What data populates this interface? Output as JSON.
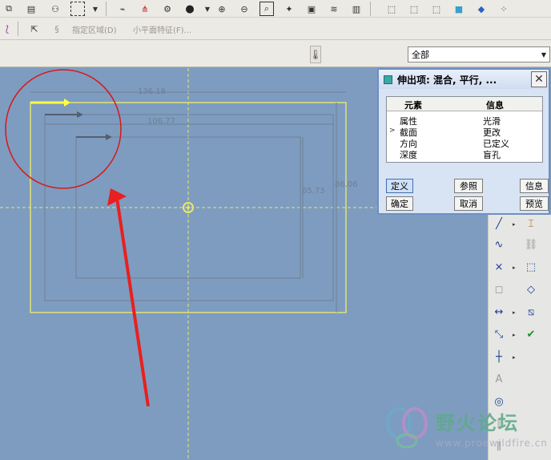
{
  "toolbar_row2": {
    "item_specify_region": "指定区域(D)",
    "item_small_surface": "小平面特征(F)..."
  },
  "toolbar_row3": {
    "filter_value": "全部"
  },
  "dimensions": {
    "width_outer": "136.18",
    "width_inner": "106.77",
    "height_inner": "65.73",
    "height_outer": "86.06"
  },
  "dialog": {
    "title": "伸出项: 混合, 平行, ...",
    "close_label": "✕",
    "columns": [
      "元素",
      "信息"
    ],
    "rows": [
      {
        "element": "属性",
        "info": "光滑"
      },
      {
        "element": "截面",
        "info": "更改",
        "current": true
      },
      {
        "element": "方向",
        "info": "已定义"
      },
      {
        "element": "深度",
        "info": "盲孔"
      }
    ],
    "buttons": {
      "define": "定义",
      "refs": "参照",
      "info": "信息",
      "ok": "确定",
      "cancel": "取消",
      "preview": "预览"
    }
  },
  "watermark": {
    "name": "野火论坛",
    "url": "www.proewildfire.cn"
  },
  "colors": {
    "canvas_bg": "#7e9cc0",
    "sketch_yellow": "#e8e86a",
    "sketch_dim": "#6f7f95",
    "annotation_red": "#e8201f",
    "dialog_border": "#6d8fc4"
  }
}
